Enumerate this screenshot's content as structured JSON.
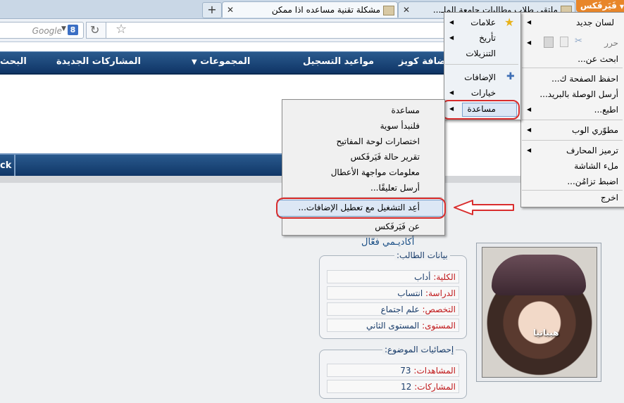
{
  "browser": {
    "firefox_button": "فَيَرفَكس",
    "new_tab": "+",
    "tabs": [
      {
        "title": "مشكلة تقنية مساعده اذا ممكن",
        "close": "✕"
      },
      {
        "title": "ملتقى طلاب وطالبات جامعة الملـ...",
        "close": "✕"
      }
    ],
    "search_placeholder": "Google",
    "search_engine_icon": "8"
  },
  "site_nav": {
    "items": [
      "البحث",
      "المشاركات الجديدة",
      "المجموعات",
      "مواعيد التسجيل",
      "إضافة كويز"
    ]
  },
  "bar2": {
    "text": "ck"
  },
  "firefox_menu": {
    "left_column": [
      {
        "label": "لسان جديد",
        "arrow": true
      },
      {
        "label": "حرر",
        "arrow": true
      },
      {
        "label": "ابحث عن...",
        "arrow": false
      },
      {
        "label": "احفظ الصفحة ك...",
        "arrow": false
      },
      {
        "label": "أرسل الوصلة بالبريد...",
        "arrow": false
      },
      {
        "label": "اطبع...",
        "arrow": true
      },
      {
        "label": "مطوّري الوب",
        "arrow": true
      },
      {
        "label": "ترميز المحارف",
        "arrow": true
      },
      {
        "label": "ملء الشاشة",
        "arrow": false
      },
      {
        "label": "اضبط تزامُن...",
        "arrow": false
      },
      {
        "label": "اخرج",
        "arrow": false
      }
    ],
    "right_column": [
      {
        "label": "علامات",
        "arrow": true,
        "icon": "star-icon"
      },
      {
        "label": "تأريخ",
        "arrow": true,
        "icon": ""
      },
      {
        "label": "التنزيلات",
        "arrow": false,
        "icon": ""
      },
      {
        "label": "الإضافات",
        "arrow": false,
        "icon": "puzzle-icon"
      },
      {
        "label": "خيارات",
        "arrow": true,
        "icon": ""
      },
      {
        "label": "مساعدة",
        "arrow": true,
        "icon": ""
      }
    ]
  },
  "help_submenu": {
    "items": [
      "مساعدة",
      "فلنبدأ سوية",
      "اختصارات لوحة المفاتيح",
      "تقرير حالة فَيَرفَكس",
      "معلومات مواجهة الأعطال",
      "أرسل تعليقًا...",
      "أعِد التشغيل مع تعطيل الإضافات...",
      "عن فَيَرفَكس"
    ]
  },
  "profile": {
    "avatar_caption": "هيباتيا",
    "rank": "أكاديـمي فعّال",
    "student": {
      "legend": "بيانات الطالب:",
      "fields": [
        {
          "label": "الكلية:",
          "value": "أداب"
        },
        {
          "label": "الدراسة:",
          "value": "انتساب"
        },
        {
          "label": "التخصص:",
          "value": "علم اجتماع"
        },
        {
          "label": "المستوى:",
          "value": "المستوى الثاني"
        }
      ]
    },
    "stats": {
      "legend": "إحصائيات الموضوع:",
      "fields": [
        {
          "label": "المشاهدات:",
          "value": "73"
        },
        {
          "label": "المشاركات:",
          "value": "12"
        }
      ]
    }
  }
}
